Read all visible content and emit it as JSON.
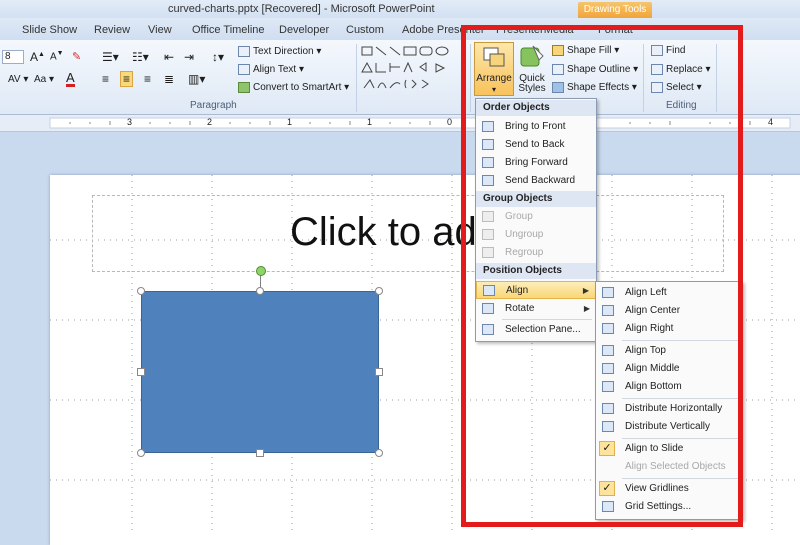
{
  "window": {
    "title": "curved-charts.pptx [Recovered]  -  Microsoft PowerPoint",
    "context_tab": "Drawing Tools"
  },
  "tabs": [
    "Slide Show",
    "Review",
    "View",
    "Office Timeline",
    "Developer",
    "Custom",
    "Adobe Presenter",
    "PresenterMedia",
    "Format"
  ],
  "ribbon": {
    "font_size": "8",
    "paragraph_label": "Paragraph",
    "text_direction": "Text Direction",
    "align_text": "Align Text",
    "convert_smartart": "Convert to SmartArt",
    "arrange": "Arrange",
    "quick_styles": "Quick Styles",
    "shape_fill": "Shape Fill",
    "shape_outline": "Shape Outline",
    "shape_effects": "Shape Effects",
    "find": "Find",
    "replace": "Replace",
    "select": "Select",
    "editing_label": "Editing"
  },
  "ruler": {
    "marks": [
      "4",
      "3",
      "2",
      "1",
      "0",
      "1",
      "2",
      "3",
      "4"
    ]
  },
  "slide": {
    "title_placeholder": "Click to add title"
  },
  "arrange_menu": {
    "order_header": "Order Objects",
    "bring_to_front": "Bring to Front",
    "send_to_back": "Send to Back",
    "bring_forward": "Bring Forward",
    "send_backward": "Send Backward",
    "group_header": "Group Objects",
    "group": "Group",
    "ungroup": "Ungroup",
    "regroup": "Regroup",
    "position_header": "Position Objects",
    "align": "Align",
    "rotate": "Rotate",
    "selection_pane": "Selection Pane..."
  },
  "align_menu": {
    "align_left": "Align Left",
    "align_center": "Align Center",
    "align_right": "Align Right",
    "align_top": "Align Top",
    "align_middle": "Align Middle",
    "align_bottom": "Align Bottom",
    "distribute_horizontally": "Distribute Horizontally",
    "distribute_vertically": "Distribute Vertically",
    "align_to_slide": "Align to Slide",
    "align_selected_objects": "Align Selected Objects",
    "view_gridlines": "View Gridlines",
    "grid_settings": "Grid Settings..."
  },
  "colors": {
    "highlight": "#e31b1b",
    "shape_fill": "#4f81bd",
    "context_tab": "#f1a43a"
  }
}
